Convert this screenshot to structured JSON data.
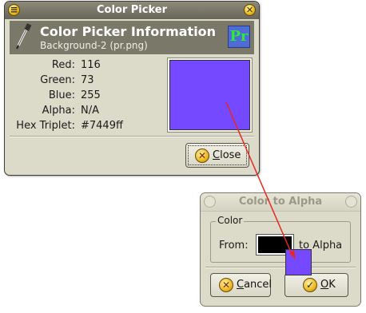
{
  "main_window": {
    "title": "Color Picker",
    "header": {
      "title": "Color Picker Information",
      "subtitle": "Background-2 (pr.png)",
      "logo_text": "Pr"
    },
    "info": {
      "red_label": "Red:",
      "red_value": "116",
      "green_label": "Green:",
      "green_value": "73",
      "blue_label": "Blue:",
      "blue_value": "255",
      "alpha_label": "Alpha:",
      "alpha_value": "N/A",
      "hex_label": "Hex Triplet:",
      "hex_value": "#7449ff"
    },
    "swatch_color": "#7449ff",
    "close_button": {
      "mnemonic": "C",
      "rest": "lose",
      "icon": "cancel-x-icon"
    }
  },
  "color_to_alpha_window": {
    "title": "Color to Alpha",
    "group_label": "Color",
    "from_label": "From:",
    "from_color": "#000000",
    "to_label": "to Alpha",
    "cancel_button": {
      "mnemonic": "C",
      "rest": "ancel",
      "icon": "cancel-x-icon"
    },
    "ok_button": {
      "mnemonic": "O",
      "rest": "K",
      "icon": "checkmark-icon"
    }
  },
  "drag": {
    "swatch_color": "#7449ff",
    "arrow_color": "#e8281e"
  },
  "colors": {
    "titlebar_active": "#7a7868",
    "window_bg": "#dcdac9"
  }
}
